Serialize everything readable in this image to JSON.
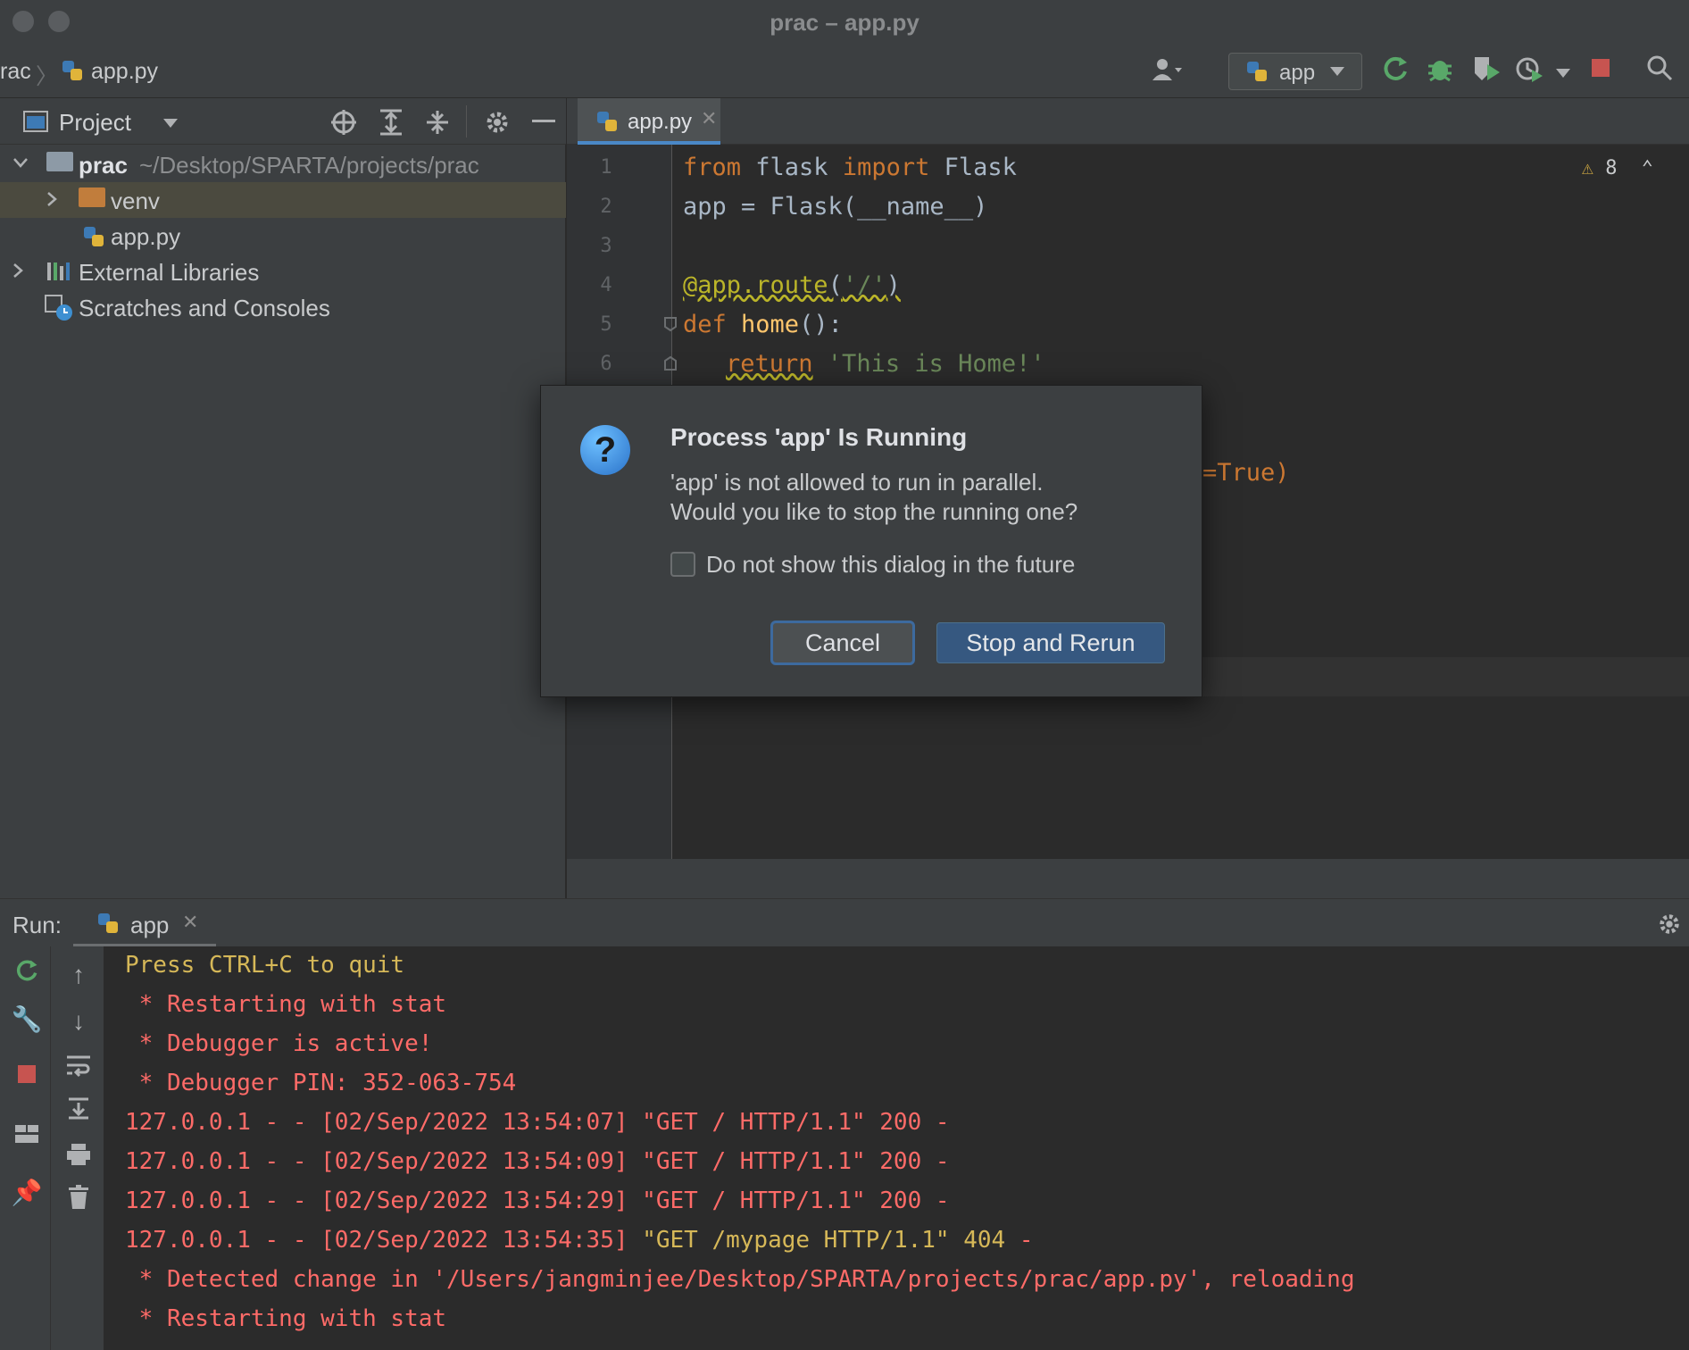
{
  "window": {
    "title": "prac – app.py"
  },
  "breadcrumb": {
    "project": "rac",
    "file": "app.py"
  },
  "toolbar": {
    "run_config": "app"
  },
  "project_panel": {
    "title": "Project",
    "root_name": "prac",
    "root_path": "~/Desktop/SPARTA/projects/prac",
    "items": [
      {
        "label": "venv"
      },
      {
        "label": "app.py"
      },
      {
        "label": "External Libraries"
      },
      {
        "label": "Scratches and Consoles"
      }
    ]
  },
  "editor": {
    "tab": "app.py",
    "warnings": "8",
    "line_numbers": [
      "1",
      "2",
      "3",
      "4",
      "5",
      "6"
    ],
    "lines": [
      {
        "kw1": "from",
        "t1": " flask ",
        "kw2": "import",
        "t2": " Flask"
      },
      {
        "text": "app = Flask(__name__)"
      },
      {
        "dec": "@app.route",
        "t": "(",
        "str": "'/'",
        "t2": ")"
      },
      {
        "kw": "def",
        "fn": " home",
        "t": "():"
      },
      {
        "kw": "return",
        "str": " 'This is Home!'"
      }
    ],
    "partial_visible": "=True)"
  },
  "run": {
    "label": "Run:",
    "tab": "app",
    "console": [
      {
        "text": "Press CTRL+C to quit",
        "color": "yellow"
      },
      {
        "text": " * Restarting with stat",
        "color": "red"
      },
      {
        "text": " * Debugger is active!",
        "color": "red"
      },
      {
        "text": " * Debugger PIN: 352-063-754",
        "color": "red"
      },
      {
        "text": "127.0.0.1 - - [02/Sep/2022 13:54:07] \"GET / HTTP/1.1\" 200 -",
        "color": "red"
      },
      {
        "text": "127.0.0.1 - - [02/Sep/2022 13:54:09] \"GET / HTTP/1.1\" 200 -",
        "color": "red"
      },
      {
        "text": "127.0.0.1 - - [02/Sep/2022 13:54:29] \"GET / HTTP/1.1\" 200 -",
        "color": "red"
      },
      {
        "pre": "127.0.0.1 - - [02/Sep/2022 13:54:35] ",
        "mid": "\"GET /mypage HTTP/1.1\" 404",
        "post": " -",
        "color": "mixed"
      },
      {
        "text": " * Detected change in '/Users/jangminjee/Desktop/SPARTA/projects/prac/app.py', reloading",
        "color": "red"
      },
      {
        "text": " * Restarting with stat",
        "color": "red"
      }
    ]
  },
  "dialog": {
    "title": "Process 'app' Is Running",
    "message_line1": "'app' is not allowed to run in parallel.",
    "message_line2": "Would you like to stop the running one?",
    "checkbox_label": "Do not show this dialog in the future",
    "cancel_label": "Cancel",
    "confirm_label": "Stop and Rerun"
  },
  "colors": {
    "accent": "#365880",
    "console_red": "#ff6b68",
    "console_yellow": "#d6b858"
  }
}
